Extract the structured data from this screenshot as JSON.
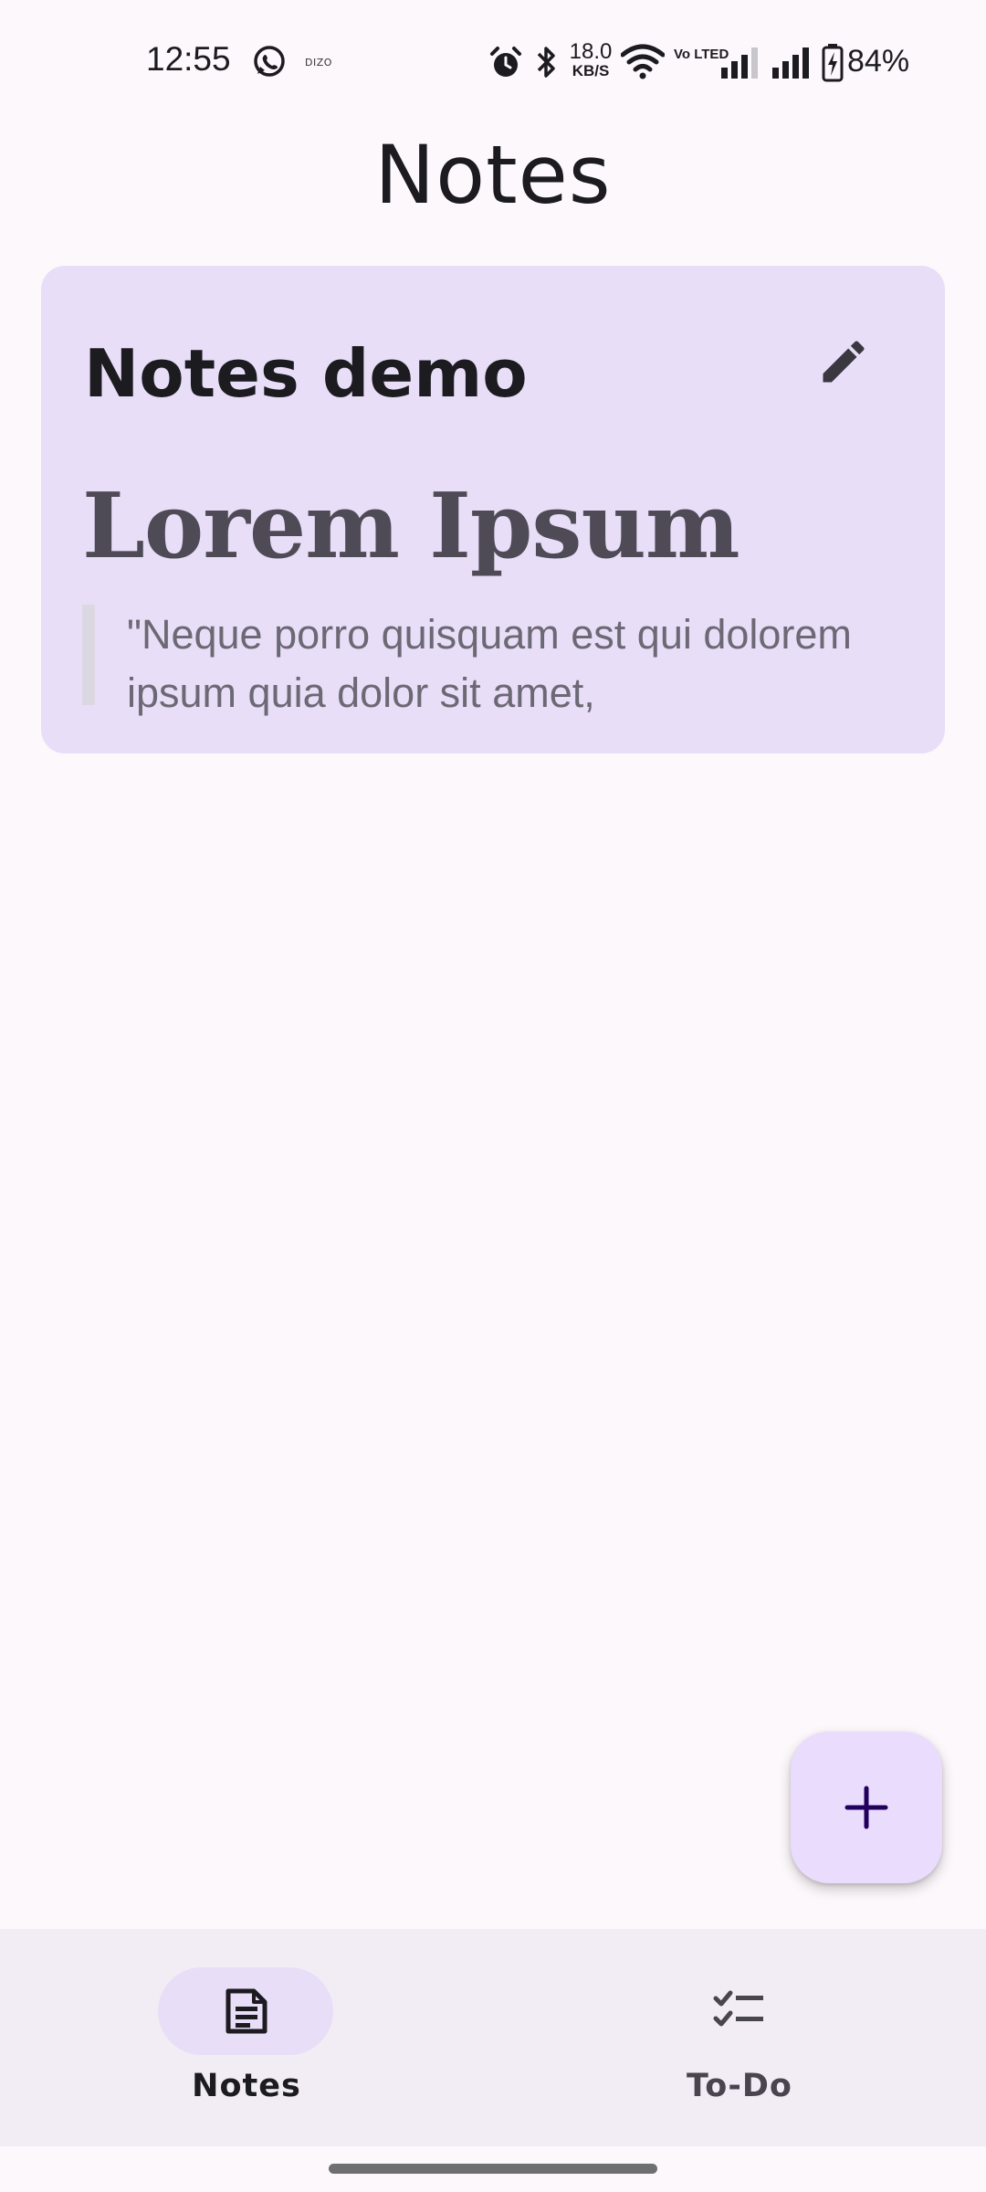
{
  "status_bar": {
    "time": "12:55",
    "tiny_label": "DIZO",
    "net_speed_value": "18.0",
    "net_speed_unit": "KB/S",
    "volte": "Vo LTED",
    "battery": "84%"
  },
  "page": {
    "title": "Notes"
  },
  "notes": [
    {
      "title": "Notes demo",
      "heading": "Lorem Ipsum",
      "quote": "\"Neque porro quisquam est qui dolorem ipsum quia dolor sit amet,"
    }
  ],
  "fab": {
    "icon": "plus-icon"
  },
  "bottom_nav": {
    "items": [
      {
        "label": "Notes",
        "icon": "note-icon",
        "selected": true
      },
      {
        "label": "To-Do",
        "icon": "checklist-icon",
        "selected": false
      }
    ]
  },
  "colors": {
    "background": "#fdf8fc",
    "card": "#e8def8",
    "fab": "#eadcfc",
    "nav_bar": "#f2edf4",
    "nav_indicator": "#e8def8",
    "text_primary": "#1c1b1f"
  }
}
